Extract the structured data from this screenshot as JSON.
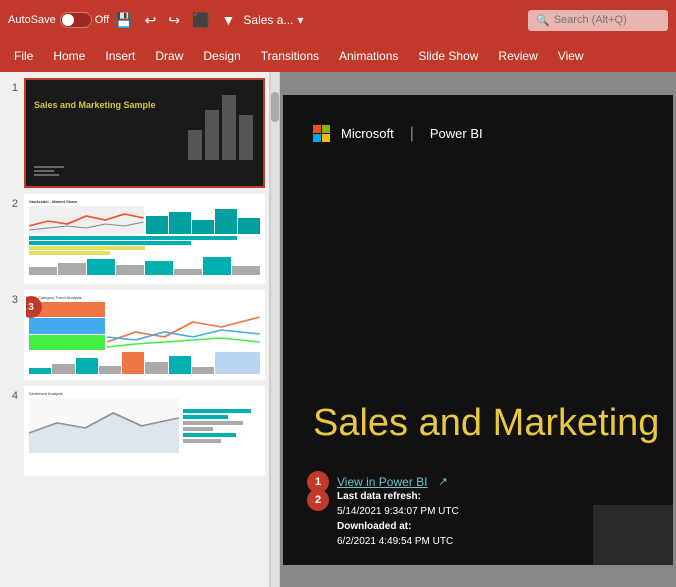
{
  "titlebar": {
    "autosave_label": "AutoSave",
    "toggle_state": "Off",
    "title": "Sales a...",
    "search_placeholder": "Search (Alt+Q)"
  },
  "menubar": {
    "items": [
      {
        "label": "File",
        "active": false
      },
      {
        "label": "Home",
        "active": false
      },
      {
        "label": "Insert",
        "active": false
      },
      {
        "label": "Draw",
        "active": false
      },
      {
        "label": "Design",
        "active": false
      },
      {
        "label": "Transitions",
        "active": false
      },
      {
        "label": "Animations",
        "active": false
      },
      {
        "label": "Slide Show",
        "active": false
      },
      {
        "label": "Review",
        "active": false
      },
      {
        "label": "View",
        "active": false
      }
    ]
  },
  "slides": {
    "slide1": {
      "num": "1",
      "title": "Sales and Marketing Sample",
      "selected": true
    },
    "slide2": {
      "num": "2",
      "header": "VanArsdel - Market Share"
    },
    "slide3": {
      "num": "3",
      "badge": "3",
      "header": "YTD Category Trend Analysis"
    },
    "slide4": {
      "num": "4",
      "header": "Sentiment Analysis"
    }
  },
  "main_slide": {
    "ms_logo_text": "Microsoft",
    "separator": "|",
    "pbi_text": "Power BI",
    "title": "Sales and Marketing",
    "badge1": {
      "num": "1",
      "link_text": "View in Power BI",
      "link_arrow": "↗"
    },
    "badge2": {
      "num": "2",
      "line1_label": "Last data refresh:",
      "line1_value": "5/14/2021 9:34:07 PM UTC",
      "line2_label": "Downloaded at:",
      "line2_value": "6/2/2021 4:49:54 PM UTC"
    }
  }
}
